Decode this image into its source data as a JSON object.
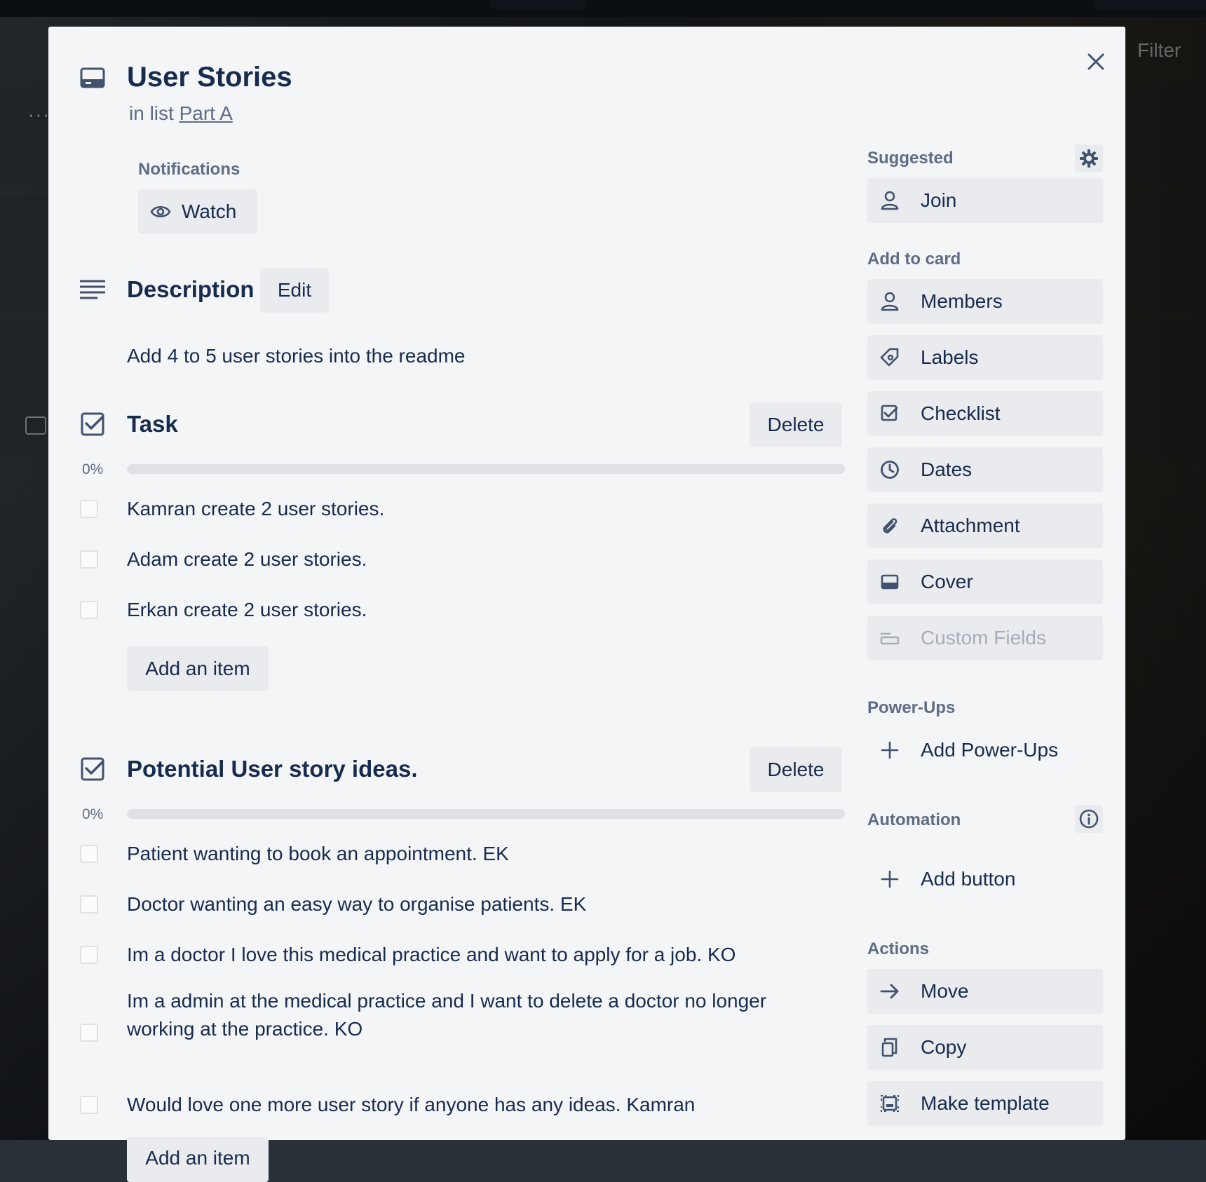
{
  "background": {
    "filter_label": "Filter"
  },
  "card": {
    "title": "User Stories",
    "list_prefix": "in list",
    "list_name": "Part A"
  },
  "notifications": {
    "label": "Notifications",
    "watch_label": "Watch"
  },
  "description": {
    "heading": "Description",
    "edit_label": "Edit",
    "text": "Add 4 to 5 user stories into the readme"
  },
  "checklists": [
    {
      "title": "Task",
      "delete_label": "Delete",
      "progress_text": "0%",
      "progress": 0,
      "items": [
        {
          "text": "Kamran create 2 user stories.",
          "checked": false
        },
        {
          "text": "Adam create 2 user stories.",
          "checked": false
        },
        {
          "text": "Erkan create 2 user stories.",
          "checked": false
        }
      ],
      "add_item_label": "Add an item"
    },
    {
      "title": "Potential User story ideas.",
      "delete_label": "Delete",
      "progress_text": "0%",
      "progress": 0,
      "items": [
        {
          "text": "Patient wanting to book an appointment. EK",
          "checked": false
        },
        {
          "text": "Doctor wanting an easy way to organise patients. EK",
          "checked": false
        },
        {
          "text": "Im a doctor I love this medical practice and want to apply for a job. KO",
          "checked": false
        },
        {
          "text": "Im a admin at the medical practice and I want to delete a doctor no longer working at the practice. KO",
          "checked": false
        },
        {
          "text": "Would love one more user story if anyone has any ideas. Kamran",
          "checked": false
        }
      ],
      "add_item_label": "Add an item"
    }
  ],
  "sidebar": {
    "suggested": {
      "label": "Suggested",
      "join_label": "Join"
    },
    "add_to_card": {
      "label": "Add to card",
      "members": "Members",
      "labels": "Labels",
      "checklist": "Checklist",
      "dates": "Dates",
      "attachment": "Attachment",
      "cover": "Cover",
      "custom_fields": "Custom Fields"
    },
    "power_ups": {
      "label": "Power-Ups",
      "add_label": "Add Power-Ups"
    },
    "automation": {
      "label": "Automation",
      "add_button_label": "Add button"
    },
    "actions": {
      "label": "Actions",
      "move": "Move",
      "copy": "Copy",
      "make_template": "Make template"
    }
  },
  "colors": {
    "text": "#172b4d",
    "muted": "#5e6c84",
    "button_bg": "#e9ebee",
    "modal_bg": "#f4f5f7",
    "progress_track": "#dfe1e6"
  }
}
